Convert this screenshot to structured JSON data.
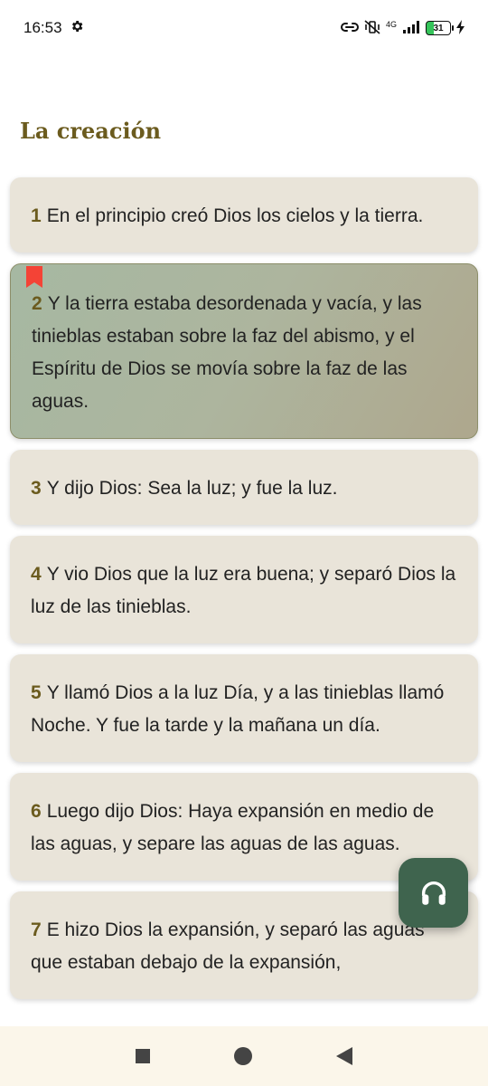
{
  "status_bar": {
    "time": "16:53",
    "network": "4G",
    "battery_level": "31"
  },
  "chapter": {
    "title": "La creación"
  },
  "verses": [
    {
      "num": "1",
      "text": "En el principio creó Dios los cielos y la tierra."
    },
    {
      "num": "2",
      "text": "Y la tierra estaba desordenada y vacía, y las tinieblas estaban sobre la faz del abismo, y el Espíritu de Dios se movía sobre la faz de las aguas."
    },
    {
      "num": "3",
      "text": "Y dijo Dios: Sea la luz; y fue la luz."
    },
    {
      "num": "4",
      "text": "Y vio Dios que la luz era buena; y separó Dios la luz de las tinieblas."
    },
    {
      "num": "5",
      "text": "Y llamó Dios a la luz Día, y a las tinieblas llamó Noche. Y fue la tarde y la mañana un día."
    },
    {
      "num": "6",
      "text": "Luego dijo Dios: Haya expansión en medio de las aguas, y separe las aguas de las aguas."
    },
    {
      "num": "7",
      "text": "E hizo Dios la expansión, y separó las aguas que estaban debajo de la expansión,"
    }
  ],
  "colors": {
    "accent": "#6b5b1e",
    "card": "#e9e4d9",
    "fab": "#3f644e",
    "bookmark": "#f44336"
  },
  "icons": {
    "settings": "gear-icon",
    "fab": "headphones-icon",
    "bookmark": "bookmark-icon",
    "nav_recents": "square-icon",
    "nav_home": "circle-icon",
    "nav_back": "triangle-back-icon"
  }
}
